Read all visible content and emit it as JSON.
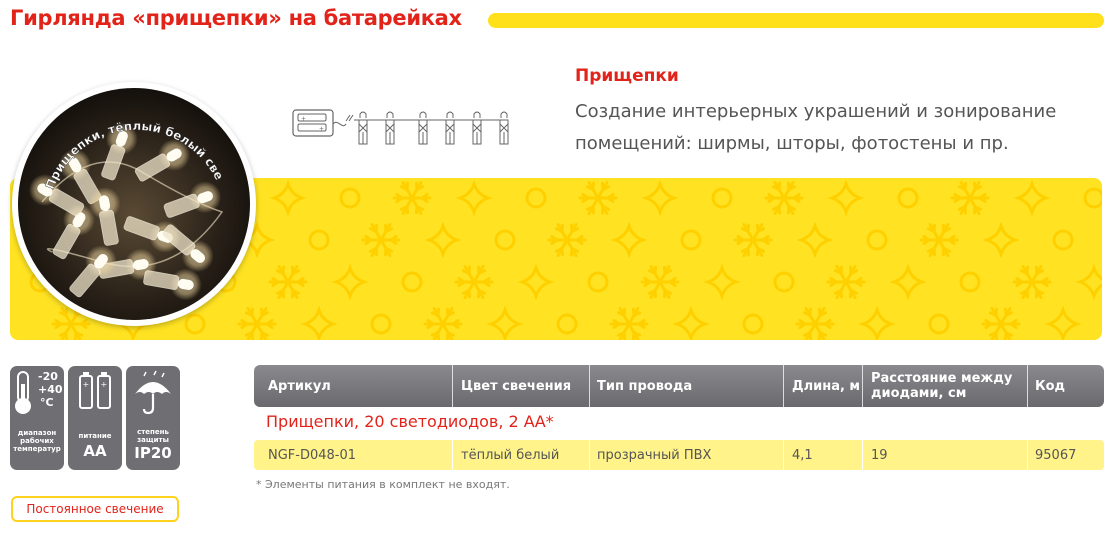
{
  "header": {
    "title": "Гирлянда «прищепки» на батарейках",
    "accent_color": "#e2231a",
    "bar_color": "#ffe01a"
  },
  "photo": {
    "caption": "Прищепки, тёплый белый свет"
  },
  "description": {
    "title": "Прищепки",
    "text": "Создание интерьерных украшений и зонирование помещений: ширмы, шторы, фотостены и пр."
  },
  "specs": {
    "temperature": {
      "range_low": "-20",
      "range_high": "+40",
      "unit": "°C",
      "label": "диапазон рабочих температур",
      "icon": "thermometer-icon"
    },
    "power": {
      "value": "AA",
      "label": "питание",
      "icon": "battery-icon"
    },
    "protection": {
      "value": "IP20",
      "label": "степень защиты",
      "icon": "umbrella-icon"
    }
  },
  "badge": {
    "label": "Постоянное свечение"
  },
  "table": {
    "headers": [
      "Артикул",
      "Цвет свечения",
      "Тип провода",
      "Длина, м",
      "Расстояние между диодами, см",
      "Код"
    ],
    "group_title": "Прищепки, 20 светодиодов, 2 АА*",
    "rows": [
      [
        "NGF-D048-01",
        "тёплый белый",
        "прозрачный ПВХ",
        "4,1",
        "19",
        "95067"
      ]
    ],
    "footnote": "* Элементы питания в комплект не входят."
  }
}
